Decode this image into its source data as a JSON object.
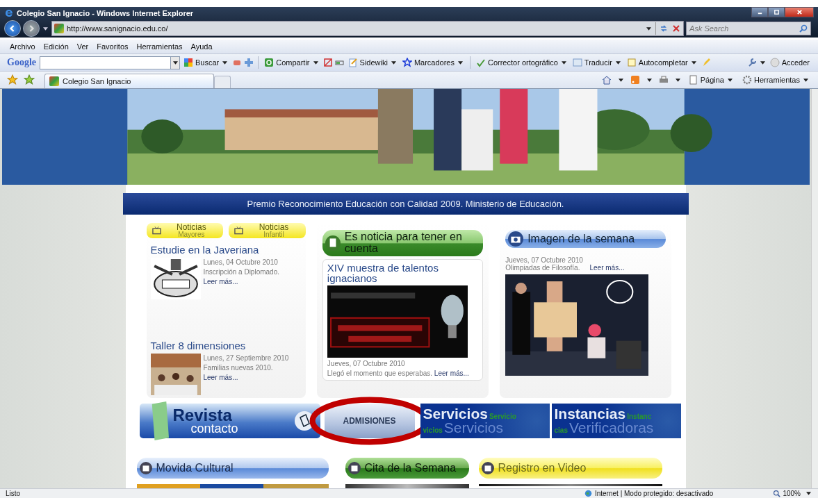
{
  "window": {
    "title": "Colegio San Ignacio - Windows Internet Explorer"
  },
  "address_bar": {
    "url": "http://www.sanignacio.edu.co/"
  },
  "search": {
    "placeholder": "Ask Search"
  },
  "menu": [
    "Archivo",
    "Edición",
    "Ver",
    "Favoritos",
    "Herramientas",
    "Ayuda"
  ],
  "google_toolbar": {
    "brand": "Google",
    "labels": [
      "Buscar",
      "Compartir",
      "Sidewiki",
      "Marcadores",
      "Corrector ortográfico",
      "Traducir",
      "Autocompletar"
    ],
    "account": "Acceder"
  },
  "tabs": [
    {
      "label": "Colegio San Ignacio",
      "selected": true
    }
  ],
  "command_bar": [
    "Página",
    "Herramientas"
  ],
  "page": {
    "ribbon": "Premio Reconocimiento Educación con Calidad 2009. Ministerio de Educación.",
    "news": {
      "tabs": [
        {
          "label": "Noticias",
          "sub": "Mayores"
        },
        {
          "label": "Noticias",
          "sub": "Infantil"
        }
      ],
      "items": [
        {
          "title": "Estudie en la Javeriana",
          "date": "Lunes, 04 Octubre 2010",
          "text": "Inscripción a Diplomado.",
          "more": "Leer más..."
        },
        {
          "title": "Taller 8 dimensiones",
          "date": "Lunes, 27 Septiembre 2010",
          "text": "Familias nuevas 2010.",
          "more": "Leer más..."
        }
      ]
    },
    "featured": {
      "header": "Es noticia para tener en cuenta",
      "title": "XIV muestra de talentos ignacianos",
      "date": "Jueves, 07 Octubre 2010",
      "text": "Llegó el momento que esperabas.",
      "more": "Leer más..."
    },
    "image_of_week": {
      "header": "Imagen de la semana",
      "date": "Jueves, 07 Octubre 2010",
      "text": "Olimpiadas de Filosofía.",
      "more": "Leer más..."
    },
    "banners": [
      {
        "kind": "revista",
        "title": "Revista",
        "subtitle": "contacto",
        "circled": false
      },
      {
        "kind": "admisiones",
        "title": "ADMISIONES",
        "circled": true
      },
      {
        "kind": "servicios",
        "title": "Servicios",
        "subtitle": "Servicios",
        "echo_top": "Servicio",
        "echo_bottom": "vicios",
        "circled": false
      },
      {
        "kind": "instancias",
        "title": "Instancias",
        "subtitle": "Verificadoras",
        "echo_top": "Instanc",
        "echo_bottom": "cias",
        "circled": false
      }
    ],
    "sections": [
      {
        "kind": "blue",
        "title": "Movida Cultural"
      },
      {
        "kind": "green",
        "title": "Cita de la Semana"
      },
      {
        "kind": "yellow",
        "title": "Registro en Video"
      }
    ]
  },
  "status_bar": {
    "text": "Listo",
    "zone": "Internet | Modo protegido: desactivado",
    "zoom": "100%"
  }
}
